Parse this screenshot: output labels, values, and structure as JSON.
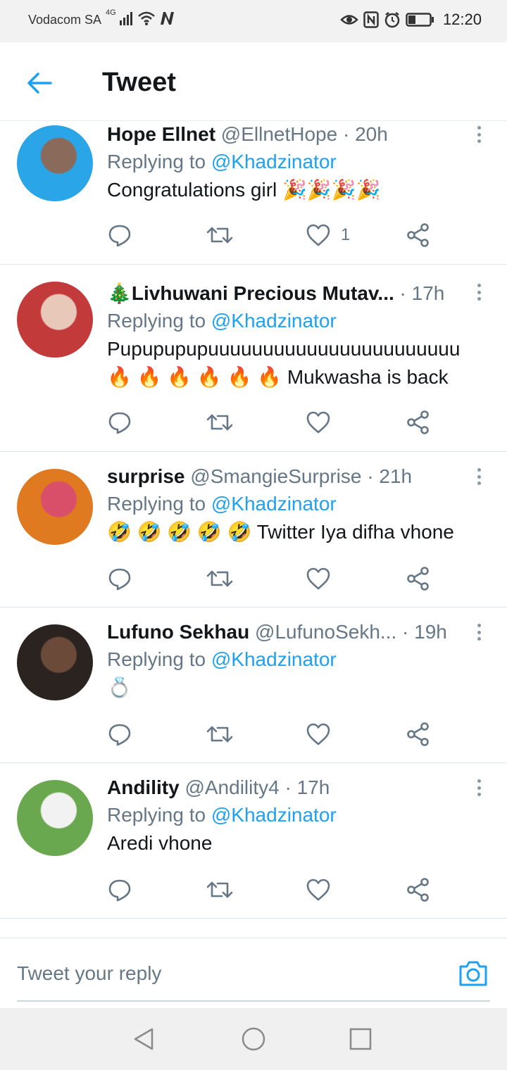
{
  "status_bar": {
    "carrier": "Vodacom SA",
    "network": "4G",
    "time": "12:20",
    "icons": [
      "signal-icon",
      "wifi-icon",
      "nfc-n-icon",
      "eye-icon",
      "nfc-icon",
      "alarm-icon",
      "battery-icon"
    ]
  },
  "header": {
    "title": "Tweet",
    "back_icon": "arrow-left-icon"
  },
  "colors": {
    "accent": "#1da1f2",
    "secondary_text": "#657786",
    "primary_text": "#14171a"
  },
  "tweets": [
    {
      "name": "Hope Ellnet",
      "handle": "@EllnetHope",
      "separator": "·",
      "time": "20h",
      "replying_prefix": "Replying to",
      "replying_to": "@Khadzinator",
      "text": "Congratulations girl 🎉🎉🎉🎉",
      "like_count": "1",
      "avatar_colors": [
        "#2aa6e8",
        "#8a6a5a"
      ]
    },
    {
      "name": "🎄Livhuwani Precious Mutav...",
      "handle": "",
      "separator": "·",
      "time": "17h",
      "replying_prefix": "Replying to",
      "replying_to": "@Khadzinator",
      "text": "Pupupupupuuuuuuuuuuuuuuuuuuuuuuu\n🔥 🔥 🔥 🔥 🔥 🔥 Mukwasha is back",
      "like_count": "",
      "avatar_colors": [
        "#c23a3a",
        "#e8c8b8"
      ]
    },
    {
      "name": "surprise",
      "handle": "@SmangieSurprise",
      "separator": "·",
      "time": "21h",
      "replying_prefix": "Replying to",
      "replying_to": "@Khadzinator",
      "text": "🤣 🤣 🤣 🤣 🤣 Twitter Iya difha vhone",
      "like_count": "",
      "avatar_colors": [
        "#e07a20",
        "#d94f6a"
      ]
    },
    {
      "name": "Lufuno Sekhau",
      "handle": "@LufunoSekh...",
      "separator": "·",
      "time": "19h",
      "replying_prefix": "Replying to",
      "replying_to": "@Khadzinator",
      "text": "💍",
      "like_count": "",
      "avatar_colors": [
        "#2b2320",
        "#6b4a3a"
      ]
    },
    {
      "name": "Andility",
      "handle": "@Andility4",
      "separator": "·",
      "time": "17h",
      "replying_prefix": "Replying to",
      "replying_to": "@Khadzinator",
      "text": "Aredi vhone",
      "like_count": "",
      "avatar_colors": [
        "#6aa84f",
        "#f2f2f2"
      ]
    }
  ],
  "reply_box": {
    "placeholder": "Tweet your reply",
    "camera_icon": "camera-icon"
  },
  "nav_bar": {
    "buttons": [
      "back-triangle-icon",
      "home-circle-icon",
      "recents-square-icon"
    ]
  }
}
